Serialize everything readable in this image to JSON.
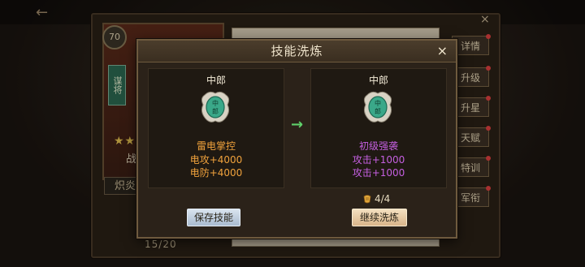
{
  "modal": {
    "title": "技能洗炼",
    "close": "×",
    "left": {
      "header": "中郎",
      "skill_name": "雷电掌控",
      "stats": [
        "电攻+4000",
        "电防+4000"
      ],
      "button": "保存技能"
    },
    "right": {
      "header": "中郎",
      "skill_name": "初级强袭",
      "stats": [
        "攻击+1000",
        "攻击+1000"
      ],
      "cost": "4/4",
      "button": "继续洗炼"
    },
    "arrow": "→",
    "badge_text": "中郎"
  },
  "background": {
    "hero_level": "70",
    "hero_class": "谋将",
    "hero_stars": "★★",
    "hero_word": "战",
    "skill_strip": "炽炎",
    "count": "15/20",
    "close": "×",
    "tabs": [
      "详情",
      "升级",
      "升星",
      "天赋",
      "特训",
      "军衔"
    ]
  },
  "colors": {
    "modal_bg": "#2b2219",
    "accent_orange": "#f0a23c",
    "accent_purple": "#c45fe0",
    "arrow_green": "#5fd06a",
    "badge_green": "#3aa889"
  },
  "icons": [
    "close-icon",
    "arrow-right-icon",
    "skill-badge-icon",
    "scroll-icon",
    "back-arrow-icon"
  ]
}
